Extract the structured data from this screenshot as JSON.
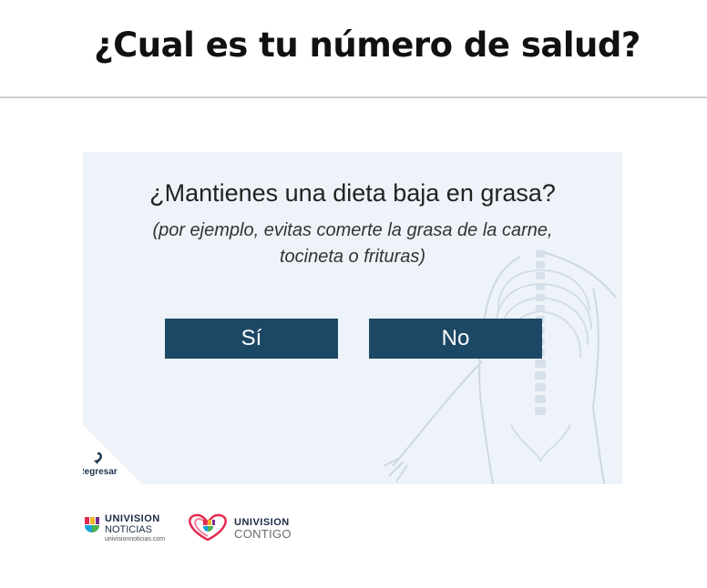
{
  "header": {
    "title": "¿Cual es tu número de salud?"
  },
  "quiz": {
    "question": "¿Mantienes una dieta baja en grasa?",
    "hint": "(por ejemplo, evitas comerte la grasa de la carne, tocineta o frituras)",
    "answers": {
      "yes": "Sí",
      "no": "No"
    },
    "back_label": "Regresar",
    "background_color": "#eef3f9",
    "button_color": "#1c4865"
  },
  "footer": {
    "logo_noticias": {
      "name": "UNIVISION",
      "sub": "NOTICIAS",
      "url": "univisionnoticias.com"
    },
    "logo_contigo": {
      "name": "UNIVISION",
      "sub": "CONTIGO"
    }
  }
}
